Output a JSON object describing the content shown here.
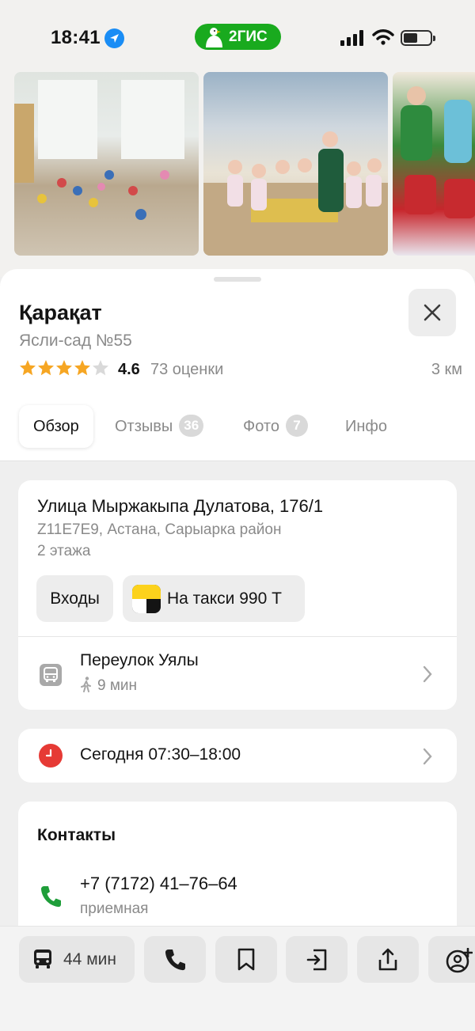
{
  "status_bar": {
    "time": "18:41",
    "brand": "2ГИС"
  },
  "place": {
    "name": "Қарақат",
    "category": "Ясли-сад №55",
    "rating": "4.6",
    "rating_fraction": 0.92,
    "rating_count": "73 оценки",
    "distance": "3 км"
  },
  "tabs": [
    {
      "label": "Обзор",
      "active": true
    },
    {
      "label": "Отзывы",
      "badge": "36"
    },
    {
      "label": "Фото",
      "badge": "7"
    },
    {
      "label": "Инфо"
    }
  ],
  "address": {
    "street": "Улица Мыржакыпа Дулатова, 176/1",
    "details": "Z11E7E9, Астана, Сарыарка район",
    "floors": "2 этажа",
    "entries_label": "Входы",
    "taxi_label": "На такси 990 Т"
  },
  "transit": {
    "stop": "Переулок Уялы",
    "walk_time": "9 мин"
  },
  "hours": {
    "text": "Сегодня 07:30–18:00"
  },
  "contacts": {
    "title": "Контакты",
    "phone": "+7 (7172) 41‒76‒64",
    "phone_note": "приемная"
  },
  "bottom_bar": {
    "route_label": "44 мин"
  },
  "colors": {
    "brand_green": "#19aa1e",
    "star": "#f6a623",
    "clock_red": "#e63a35",
    "phone_green": "#1f9e3a"
  }
}
